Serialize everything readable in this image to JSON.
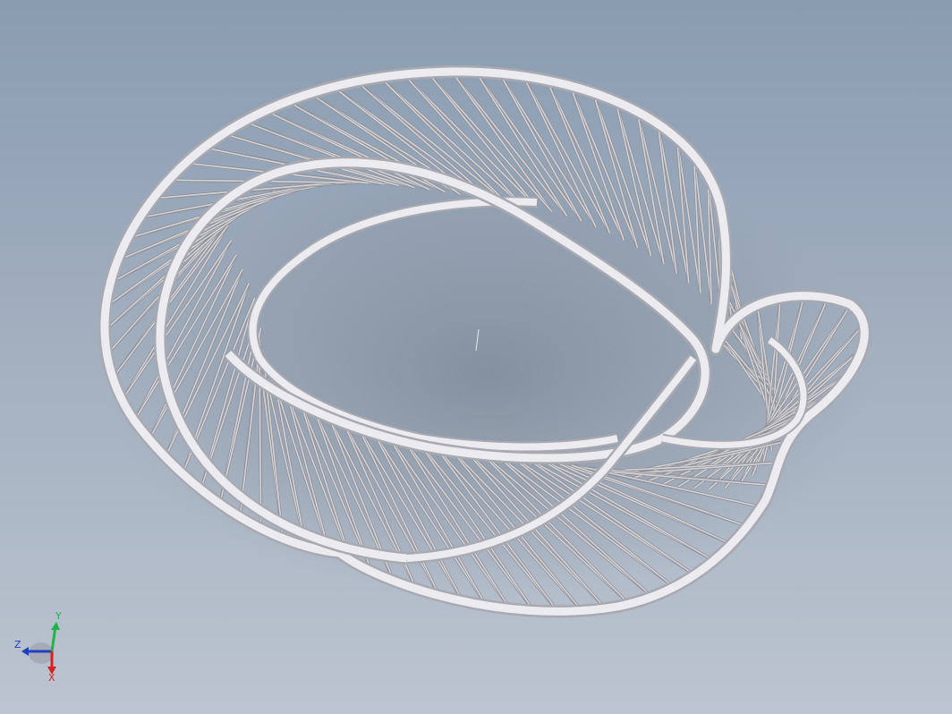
{
  "viewport": {
    "background_top": "#8a9cb0",
    "background_bottom": "#bcc4d0",
    "tube_color": "#e6e6ea",
    "tube_shadow": "#a9a9b1",
    "strut_color": "#d4d4d8",
    "strut_shadow": "#8b8b93"
  },
  "triad": {
    "y_label": "Y",
    "z_label": "Z",
    "x_label": "X",
    "y_color": "#22b24a",
    "z_color": "#1e3fbf",
    "x_color": "#d42222"
  }
}
